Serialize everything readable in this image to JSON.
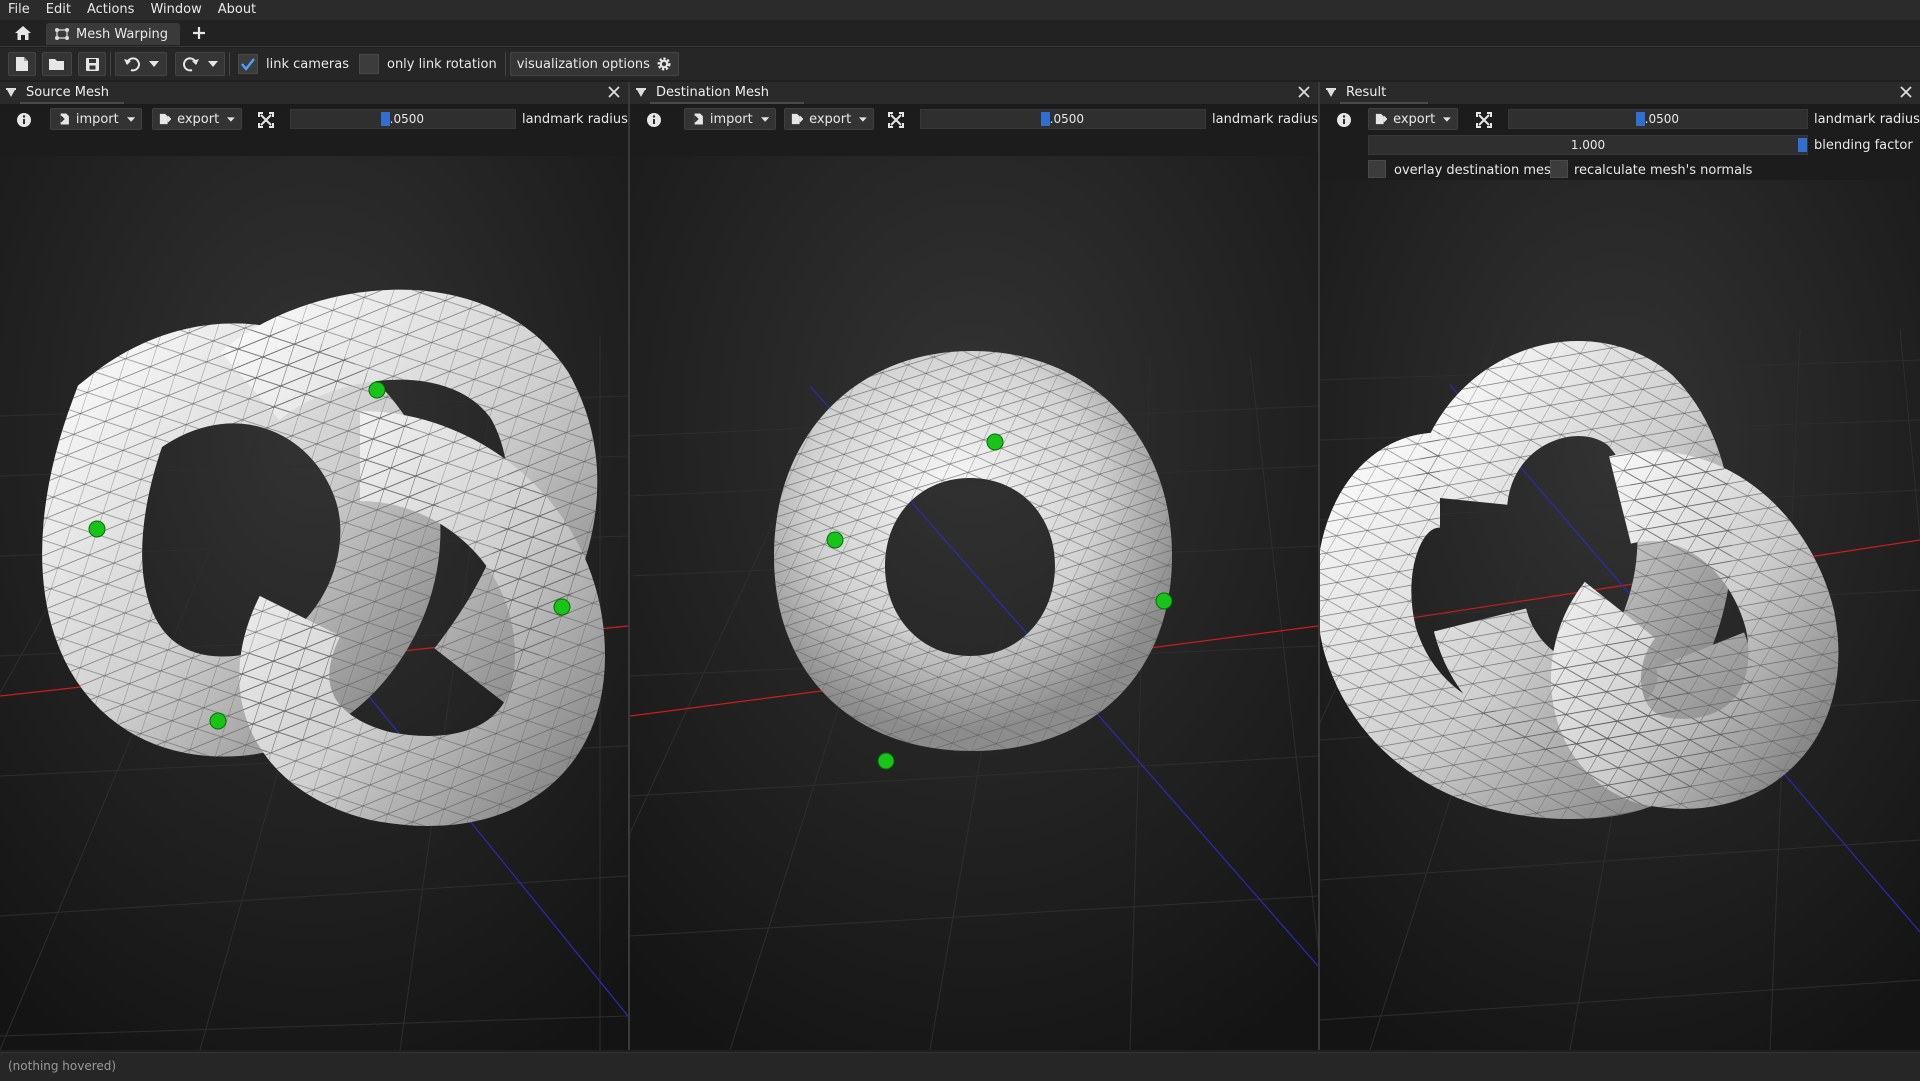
{
  "menu": [
    "File",
    "Edit",
    "Actions",
    "Window",
    "About"
  ],
  "tabs": {
    "active_label": "Mesh Warping"
  },
  "toolbar": {
    "link_cameras": "link cameras",
    "only_link_rotation": "only link rotation",
    "visualization_options": "visualization options"
  },
  "panels": {
    "source": {
      "title": "Source Mesh",
      "import": "import",
      "export": "export",
      "radius_value": "0.0500",
      "radius_label": "landmark radius"
    },
    "destination": {
      "title": "Destination Mesh",
      "import": "import",
      "export": "export",
      "radius_value": "0.0500",
      "radius_label": "landmark radius"
    },
    "result": {
      "title": "Result",
      "export": "export",
      "radius_value": "0.0500",
      "radius_label": "landmark radius",
      "blending_value": "1.000",
      "blending_label": "blending factor",
      "overlay_label": "overlay destination mesh",
      "recalc_label": "recalculate mesh's normals"
    }
  },
  "status": {
    "text": "(nothing hovered)"
  },
  "colors": {
    "landmark": "#19c419",
    "axis_x": "#c81e1e",
    "axis_z": "#2b2bb5",
    "mesh": "#e8e8e8",
    "checkbox": "#4ea0ff"
  },
  "icons": [
    "home-icon",
    "mesh-warping-icon",
    "plus-icon",
    "new-file-icon",
    "open-folder-icon",
    "save-icon",
    "undo-icon",
    "redo-icon",
    "gear-icon",
    "info-icon",
    "import-icon",
    "export-icon",
    "fit-view-icon",
    "collapse-triangle-icon",
    "close-icon",
    "checkmark-icon"
  ]
}
